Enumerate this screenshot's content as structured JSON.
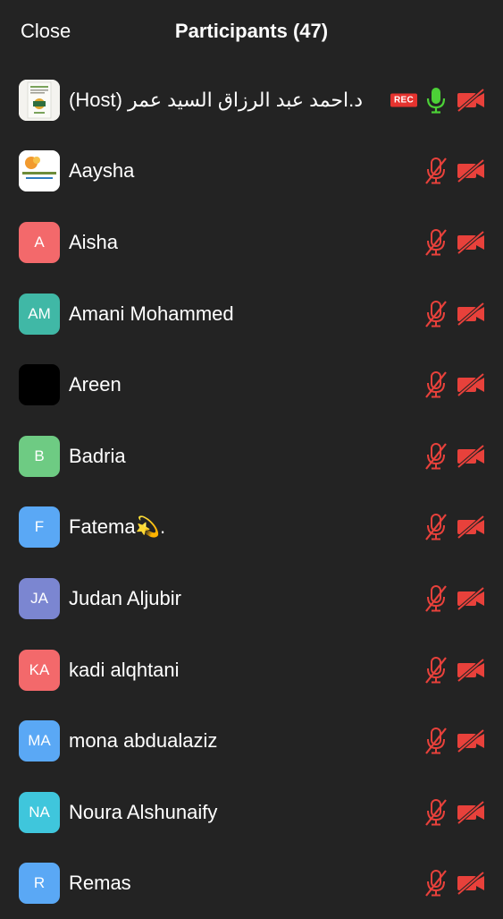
{
  "header": {
    "close_label": "Close",
    "title": "Participants (47)"
  },
  "colors": {
    "muted_red": "#e8413b",
    "mic_active_green": "#4cd137",
    "rec_red": "#e5332f"
  },
  "participants": [
    {
      "name": "د.احمد عبد الرزاق السيد عمر (Host)",
      "initials": "",
      "avatar": "book-cover-image",
      "rec": "REC",
      "mic": "on",
      "camera": "off"
    },
    {
      "name": "Aaysha",
      "initials": "",
      "avatar": "logo-image",
      "mic": "muted",
      "camera": "off"
    },
    {
      "name": "Aisha",
      "initials": "A",
      "avatar_color": "#f3696b",
      "mic": "muted",
      "camera": "off"
    },
    {
      "name": "Amani Mohammed",
      "initials": "AM",
      "avatar_color": "#40b8a6",
      "mic": "muted",
      "camera": "off"
    },
    {
      "name": "Areen",
      "initials": "",
      "avatar_color": "#000000",
      "mic": "muted",
      "camera": "off"
    },
    {
      "name": "Badria",
      "initials": "B",
      "avatar_color": "#6ecb83",
      "mic": "muted",
      "camera": "off"
    },
    {
      "name": "Fatema💫.",
      "initials": "F",
      "avatar_color": "#5aa8f5",
      "mic": "muted",
      "camera": "off"
    },
    {
      "name": "Judan Aljubir",
      "initials": "JA",
      "avatar_color": "#7b86d1",
      "mic": "muted",
      "camera": "off"
    },
    {
      "name": "kadi alqhtani",
      "initials": "KA",
      "avatar_color": "#f3696b",
      "mic": "muted",
      "camera": "off"
    },
    {
      "name": "mona abdualaziz",
      "initials": "MA",
      "avatar_color": "#5aa8f5",
      "mic": "muted",
      "camera": "off"
    },
    {
      "name": "Noura Alshunaify",
      "initials": "NA",
      "avatar_color": "#3fc6dc",
      "mic": "muted",
      "camera": "off"
    },
    {
      "name": "Remas",
      "initials": "R",
      "avatar_color": "#5aa8f5",
      "mic": "muted",
      "camera": "off"
    }
  ]
}
